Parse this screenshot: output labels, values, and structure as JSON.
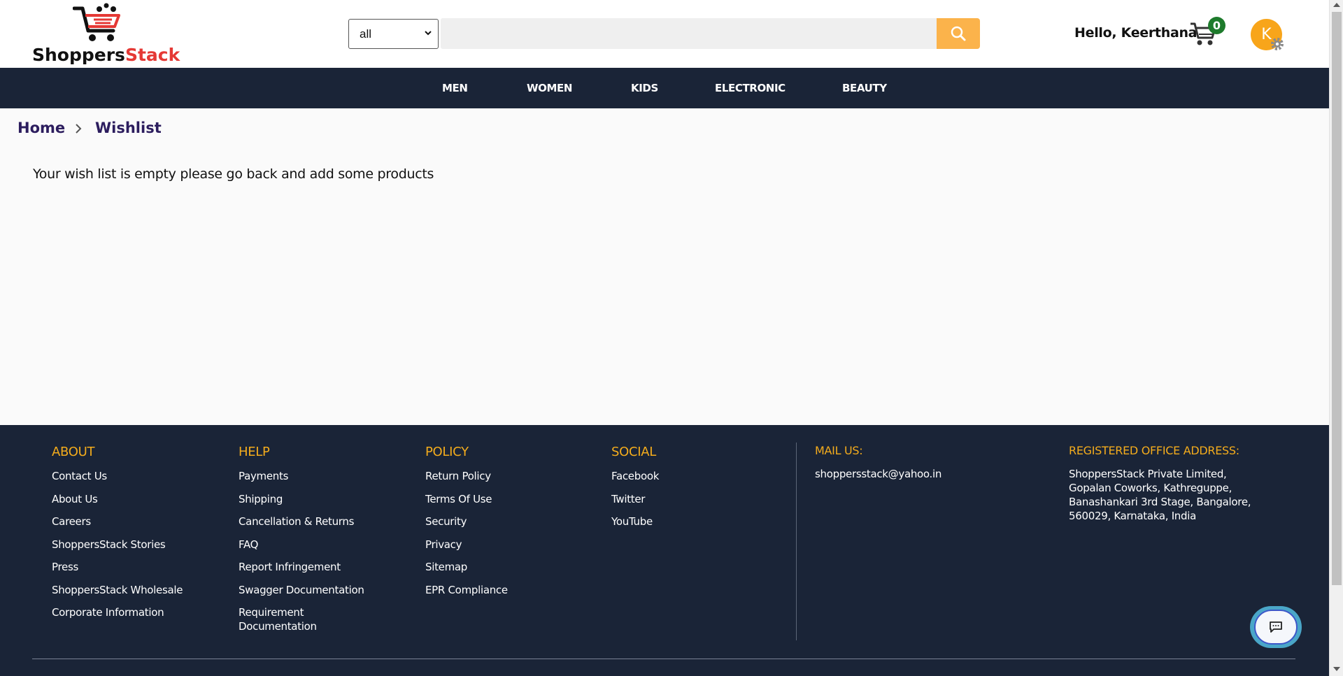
{
  "brand": {
    "name_part1": "Shoppers",
    "name_part2": "Stack"
  },
  "search": {
    "category_selected": "all",
    "query": "",
    "button_icon": "search-icon"
  },
  "user": {
    "greeting": "Hello, Keerthana",
    "cart_count": "0",
    "avatar_initial": "K"
  },
  "nav": {
    "items": [
      "MEN",
      "WOMEN",
      "KIDS",
      "ELECTRONIC",
      "BEAUTY"
    ]
  },
  "breadcrumb": {
    "home": "Home",
    "current": "Wishlist"
  },
  "main": {
    "empty_message": "Your wish list is empty please go back and add some products"
  },
  "footer": {
    "about": {
      "heading": "ABOUT",
      "links": [
        "Contact Us",
        "About Us",
        "Careers",
        "ShoppersStack Stories",
        "Press",
        "ShoppersStack Wholesale",
        "Corporate Information"
      ]
    },
    "help": {
      "heading": "HELP",
      "links": [
        "Payments",
        "Shipping",
        "Cancellation & Returns",
        "FAQ",
        "Report Infringement",
        "Swagger Documentation",
        "Requirement Documentation"
      ]
    },
    "policy": {
      "heading": "POLICY",
      "links": [
        "Return Policy",
        "Terms Of Use",
        "Security",
        "Privacy",
        "Sitemap",
        "EPR Compliance"
      ]
    },
    "social": {
      "heading": "SOCIAL",
      "links": [
        "Facebook",
        "Twitter",
        "YouTube"
      ]
    },
    "mail": {
      "heading": "MAIL US:",
      "email": "shoppersstack@yahoo.in"
    },
    "address": {
      "heading": "REGISTERED OFFICE ADDRESS:",
      "text": "ShoppersStack Private Limited, Gopalan Coworks, Kathreguppe, Banashankari 3rd Stage, Bangalore, 560029, Karnataka, India"
    }
  },
  "colors": {
    "nav_bg": "#1a2437",
    "accent": "#fbb34b",
    "footer_heading": "#f4ac1c",
    "brand_red": "#e53935",
    "cart_badge": "#1e7b2c",
    "avatar": "#f8a51a"
  }
}
